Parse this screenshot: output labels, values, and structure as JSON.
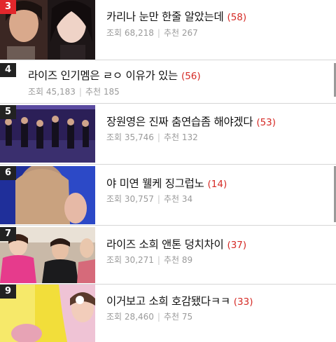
{
  "posts": [
    {
      "rank": "3",
      "title": "카리나 눈만 한줄 알았는데",
      "comments": "(58)",
      "views_label": "조회",
      "views": "68,218",
      "recommend_label": "추천",
      "recommends": "267"
    },
    {
      "rank": "4",
      "title": "라이즈 인기멤은 ㄹㅇ 이유가 있는",
      "comments": "(56)",
      "views_label": "조회",
      "views": "45,183",
      "recommend_label": "추천",
      "recommends": "185"
    },
    {
      "rank": "5",
      "title": "장원영은 진짜 춤연습좀 해야겠다",
      "comments": "(53)",
      "views_label": "조회",
      "views": "35,746",
      "recommend_label": "추천",
      "recommends": "132"
    },
    {
      "rank": "6",
      "title": "야 미연 웰케 징그럽노",
      "comments": "(14)",
      "views_label": "조회",
      "views": "30,757",
      "recommend_label": "추천",
      "recommends": "34"
    },
    {
      "rank": "7",
      "title": "라이즈 소희 앤톤 덩치차이",
      "comments": "(37)",
      "views_label": "조회",
      "views": "30,271",
      "recommend_label": "추천",
      "recommends": "89"
    },
    {
      "rank": "9",
      "title": "이거보고 소희 호감됐다ㅋㅋ",
      "comments": "(33)",
      "views_label": "조회",
      "views": "28,460",
      "recommend_label": "추천",
      "recommends": "75"
    }
  ],
  "colors": {
    "rank_hot": "#e2272c",
    "rank_default": "#222222",
    "comment_count": "#d52a25",
    "meta_text": "#9a9a9a"
  }
}
